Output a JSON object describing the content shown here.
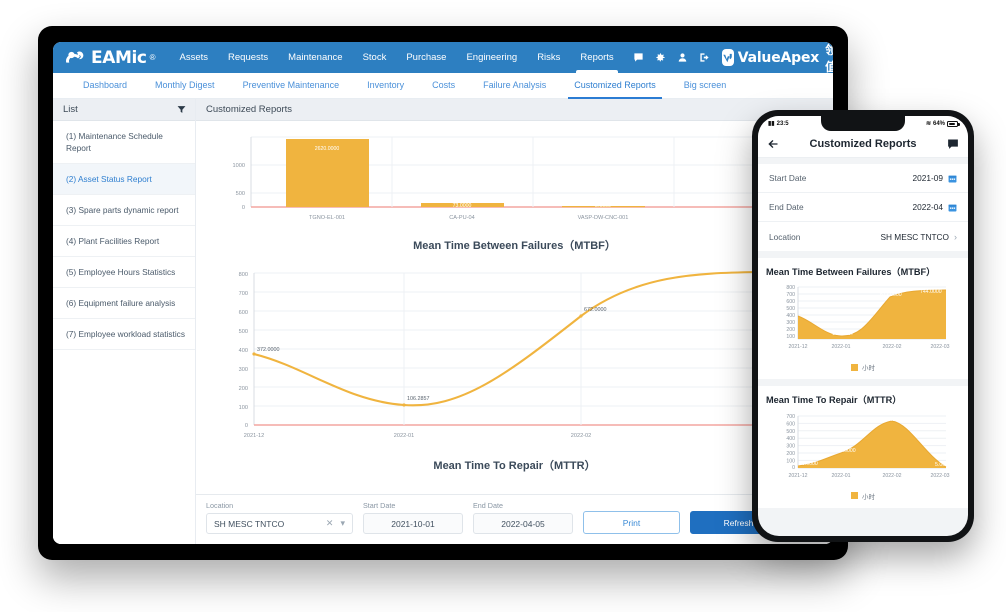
{
  "header": {
    "brand": "EAMic",
    "brand_reg": "®",
    "nav": [
      {
        "label": "Assets",
        "active": false
      },
      {
        "label": "Requests",
        "active": false
      },
      {
        "label": "Maintenance",
        "active": false
      },
      {
        "label": "Stock",
        "active": false
      },
      {
        "label": "Purchase",
        "active": false
      },
      {
        "label": "Engineering",
        "active": false
      },
      {
        "label": "Risks",
        "active": false
      },
      {
        "label": "Reports",
        "active": true
      }
    ],
    "icons": [
      "message-icon",
      "gear-icon",
      "user-icon",
      "logout-icon"
    ],
    "vendor_name": "ValueApex",
    "vendor_name_cn": "领值"
  },
  "subnav": [
    {
      "label": "Dashboard",
      "active": false
    },
    {
      "label": "Monthly Digest",
      "active": false
    },
    {
      "label": "Preventive Maintenance",
      "active": false
    },
    {
      "label": "Inventory",
      "active": false
    },
    {
      "label": "Costs",
      "active": false
    },
    {
      "label": "Failure Analysis",
      "active": false
    },
    {
      "label": "Customized Reports",
      "active": true
    },
    {
      "label": "Big screen",
      "active": false
    }
  ],
  "sidebar": {
    "title": "List",
    "filter_icon": "filter-icon",
    "items": [
      {
        "label": "(1) Maintenance Schedule Report",
        "active": false
      },
      {
        "label": "(2) Asset Status Report",
        "active": true
      },
      {
        "label": "(3) Spare parts dynamic report",
        "active": false
      },
      {
        "label": "(4) Plant Facilities Report",
        "active": false
      },
      {
        "label": "(5) Employee Hours Statistics",
        "active": false
      },
      {
        "label": "(6) Equipment failure analysis",
        "active": false
      },
      {
        "label": "(7) Employee workload statistics",
        "active": false
      }
    ]
  },
  "content": {
    "title": "Customized Reports"
  },
  "filter_bar": {
    "location_label": "Location",
    "location_value": "SH MESC TNTCO",
    "clear_icon": "close-icon",
    "dropdown_icon": "chevron-down-icon",
    "start_label": "Start Date",
    "start_value": "2021-10-01",
    "end_label": "End Date",
    "end_value": "2022-04-05",
    "print_label": "Print",
    "refresh_label": "Refresh"
  },
  "phone": {
    "status": {
      "time": "23:5",
      "battery": "64%"
    },
    "back_icon": "back-arrow-icon",
    "title": "Customized Reports",
    "message_icon": "message-icon",
    "rows": [
      {
        "label": "Start Date",
        "value": "2021-09",
        "icon": "calendar-icon"
      },
      {
        "label": "End Date",
        "value": "2022-04",
        "icon": "calendar-icon"
      },
      {
        "label": "Location",
        "value": "SH MESC TNTCO",
        "icon": "chevron-right-icon"
      }
    ],
    "legend_label": "小时"
  },
  "colors": {
    "header_blue": "#2d7fc1",
    "accent_blue": "#1f6fc0",
    "link_blue": "#4a90d9",
    "series_orange": "#f0b43f",
    "axis_pink": "#f4a5a0"
  },
  "chart_data": [
    {
      "id": "asset-status-bar",
      "type": "bar",
      "title": "",
      "categories": [
        "TGNO-EL-001",
        "CA-PU-04",
        "VASP-DW-CNC-001"
      ],
      "values": [
        2620.0,
        73.0,
        2.0
      ],
      "labels": [
        "2620.0000",
        "73.0000",
        "2.0000"
      ],
      "ylabel": "",
      "xlabel": "",
      "yticks": [
        0,
        500,
        1000
      ],
      "ylim": [
        0,
        2900
      ],
      "grid": true
    },
    {
      "id": "mtbf-line",
      "type": "line",
      "title": "Mean Time Between Failures（MTBF）",
      "categories": [
        "2021-12",
        "2022-01",
        "2022-02",
        "2022-03"
      ],
      "values": [
        372.0,
        106.2857,
        672.0,
        744.0
      ],
      "labels": [
        "372.0000",
        "106.2857",
        "672.0000",
        "744.0000"
      ],
      "yticks": [
        0,
        100,
        200,
        300,
        400,
        500,
        600,
        700,
        800
      ],
      "ylim": [
        0,
        800
      ],
      "xlabel": "",
      "ylabel": "",
      "grid": true
    },
    {
      "id": "mttr-line",
      "type": "line",
      "title": "Mean Time To Repair（MTTR）",
      "categories": [
        "2021-12",
        "2022-01",
        "2022-02",
        "2022-03"
      ],
      "values": [
        20.0,
        248.0,
        645.0,
        5.0
      ],
      "labels": [
        "20.0000",
        "248.0000",
        "645.0000",
        "5.0000"
      ],
      "yticks": [
        0,
        100,
        200,
        300,
        400,
        500,
        600,
        700
      ],
      "ylim": [
        0,
        700
      ],
      "xlabel": "",
      "ylabel": "",
      "grid": true
    },
    {
      "id": "phone-mtbf-area",
      "type": "area",
      "title": "Mean Time Between Failures（MTBF）",
      "categories": [
        "2021-12",
        "2022-01",
        "2022-02",
        "2022-03"
      ],
      "values": [
        372.0,
        106.2857,
        672.0,
        744.0
      ],
      "labels": [
        "372.0000",
        "106.2857",
        "672.0000",
        "744.0000"
      ],
      "yticks": [
        100,
        200,
        300,
        400,
        500,
        600,
        700,
        800
      ],
      "ylim": [
        0,
        800
      ],
      "legend": [
        "小时"
      ],
      "grid": true
    },
    {
      "id": "phone-mttr-area",
      "type": "area",
      "title": "Mean Time To Repair（MTTR）",
      "categories": [
        "2021-12",
        "2022-01",
        "2022-02",
        "2022-03"
      ],
      "values": [
        20.0,
        248.0,
        645.0,
        5.0
      ],
      "labels": [
        "20.0000",
        "248.0000",
        "645.0000",
        "5.0000"
      ],
      "yticks": [
        0,
        100,
        200,
        300,
        400,
        500,
        600,
        700
      ],
      "ylim": [
        0,
        700
      ],
      "legend": [
        "小时"
      ],
      "grid": true
    }
  ]
}
